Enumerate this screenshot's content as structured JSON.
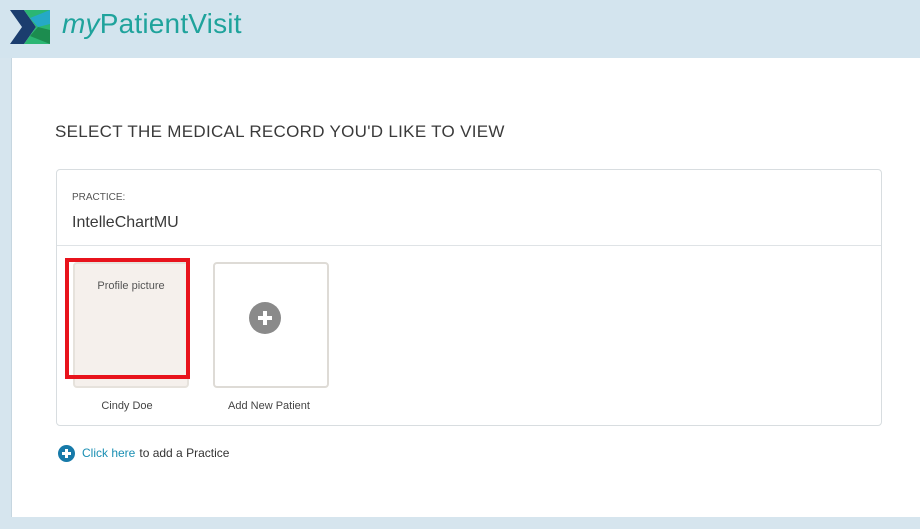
{
  "app": {
    "logo_prefix": "my",
    "logo_suffix": "PatientVisit",
    "logo_icon": "mypatientvisit-logo"
  },
  "page": {
    "heading": "SELECT THE MEDICAL RECORD YOU'D LIKE TO VIEW"
  },
  "practice": {
    "label": "PRACTICE:",
    "name": "IntelleChartMU"
  },
  "patients": [
    {
      "name": "Cindy Doe",
      "picture_alt": "Profile picture",
      "selected": true
    }
  ],
  "add_patient": {
    "label": "Add New Patient",
    "icon": "plus-circle-icon"
  },
  "add_practice": {
    "link_text": "Click here",
    "rest_text": "to add a Practice",
    "icon": "plus-circle-icon"
  },
  "colors": {
    "brand": "#1fa39c",
    "link": "#1a8fb3",
    "highlight": "#e8131c",
    "header_bg": "#d3e4ee"
  }
}
